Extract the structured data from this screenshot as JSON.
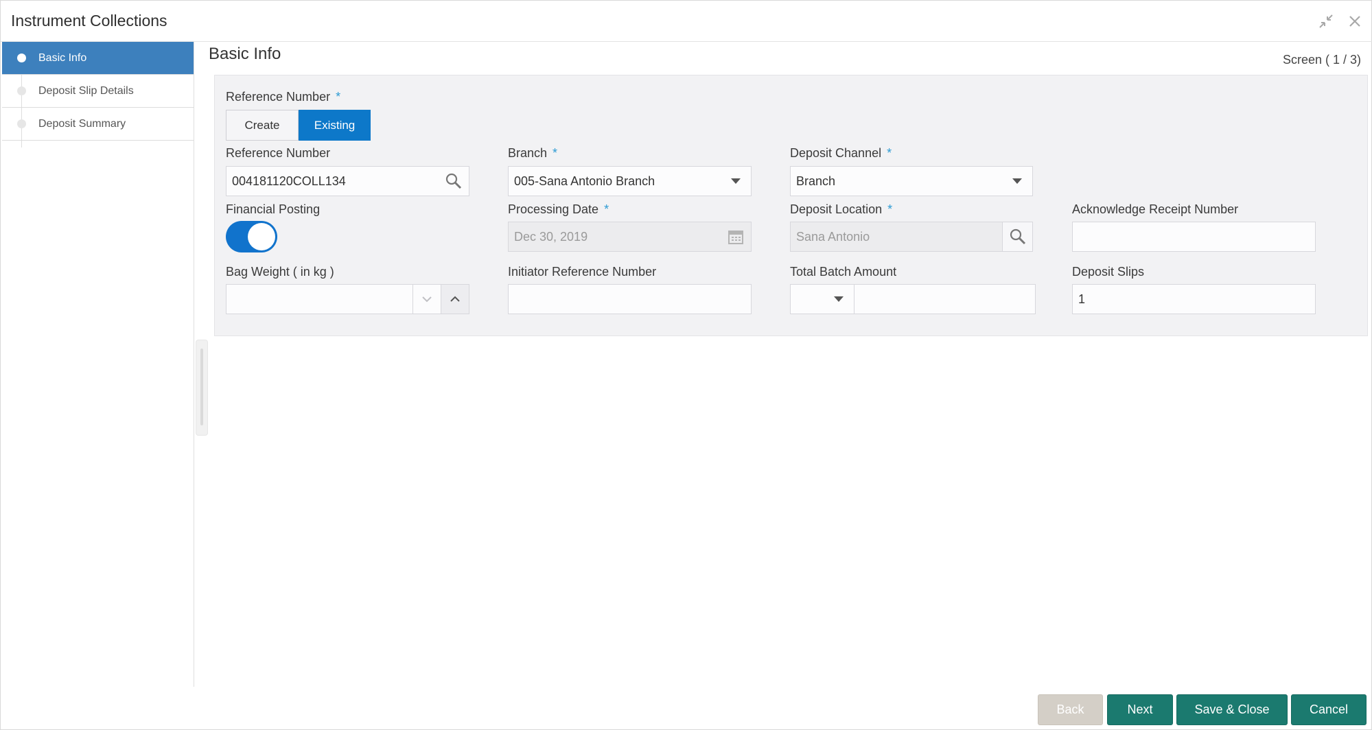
{
  "window": {
    "title": "Instrument Collections",
    "minimize_icon": "compress-arrows-icon",
    "close_icon": "close-icon"
  },
  "steps": [
    {
      "label": "Basic Info",
      "active": true
    },
    {
      "label": "Deposit Slip Details",
      "active": false
    },
    {
      "label": "Deposit Summary",
      "active": false
    }
  ],
  "page": {
    "title": "Basic Info",
    "screen_counter": "Screen ( 1 / 3)"
  },
  "form": {
    "reference_mode": {
      "label": "Reference Number",
      "required": "*",
      "options": [
        "Create",
        "Existing"
      ],
      "selected": "Existing"
    },
    "reference_number": {
      "label": "Reference Number",
      "value": "004181120COLL134",
      "icon": "search-icon"
    },
    "branch": {
      "label": "Branch",
      "required": "*",
      "value": "005-Sana Antonio Branch"
    },
    "deposit_channel": {
      "label": "Deposit Channel",
      "required": "*",
      "value": "Branch"
    },
    "financial_posting": {
      "label": "Financial Posting",
      "on": true
    },
    "processing_date": {
      "label": "Processing Date",
      "required": "*",
      "value": "Dec 30, 2019",
      "icon": "calendar-icon"
    },
    "deposit_location": {
      "label": "Deposit Location",
      "required": "*",
      "value": "Sana Antonio",
      "icon": "search-icon"
    },
    "acknowledge_receipt_number": {
      "label": "Acknowledge Receipt Number",
      "value": ""
    },
    "bag_weight": {
      "label": "Bag Weight ( in kg )",
      "value": ""
    },
    "initiator_reference_number": {
      "label": "Initiator Reference Number",
      "value": ""
    },
    "total_batch_amount": {
      "label": "Total Batch Amount",
      "currency": "",
      "value": ""
    },
    "deposit_slips": {
      "label": "Deposit Slips",
      "value": "1"
    }
  },
  "footer": {
    "back": "Back",
    "next": "Next",
    "save_close": "Save & Close",
    "cancel": "Cancel"
  },
  "colors": {
    "active_step": "#3d80bd",
    "toggle_selected": "#0d78c9",
    "switch_on": "#1173cc",
    "required": "#2d9bd3",
    "primary_button": "#1b7a6f",
    "disabled_button": "#d4cfc7"
  }
}
